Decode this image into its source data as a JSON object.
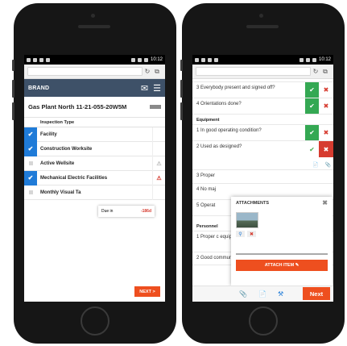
{
  "status_time": "10:12",
  "left": {
    "brand": "BRAND",
    "title": "Gas Plant North 11-21-055-20W5M",
    "column_header": "Inspection Type",
    "rows": [
      {
        "label": "Facility",
        "checked": true
      },
      {
        "label": "Construction Worksite",
        "checked": true
      },
      {
        "label": "Active Wellsite",
        "checked": false
      },
      {
        "label": "Mechanical Electric Facilities",
        "checked": true
      },
      {
        "label": "Monthly Visual Ta",
        "checked": false
      }
    ],
    "popup": {
      "label": "Due in",
      "value": "-186d"
    },
    "next_label": "NEXT >"
  },
  "right": {
    "questions": [
      {
        "text": "3 Everybody present and signed off?"
      },
      {
        "text": "4 Orientations done?"
      }
    ],
    "section_equipment": "Equipment",
    "equipment": [
      {
        "text": "1 In good operating condition?"
      },
      {
        "text": "2 Used as designed?"
      }
    ],
    "partial_rows": [
      "3 Proper",
      "4 No maj",
      "5 Operat"
    ],
    "section_personnel": "Personnel",
    "personnel": [
      {
        "text": "1 Proper c equipme"
      },
      {
        "text": "2 Good communication?"
      }
    ],
    "attachments": {
      "title": "ATTACHMENTS",
      "button_label": "ATTACH ITEM ✎"
    },
    "next_label": "Next"
  },
  "icons": {
    "check": "✔",
    "x": "✖",
    "warning": "⚠",
    "refresh": "↻",
    "tabs": "⧉",
    "mail": "✉",
    "menu": "☰",
    "search": "⚲",
    "attach": "📎",
    "document": "📄",
    "tools": "⚒"
  }
}
